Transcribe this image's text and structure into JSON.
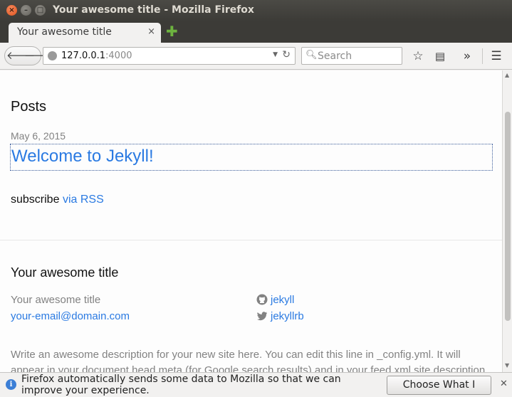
{
  "window": {
    "title": "Your awesome title - Mozilla Firefox"
  },
  "tabs": [
    {
      "label": "Your awesome title",
      "close": "×"
    }
  ],
  "navbar": {
    "url_host": "127.0.0.1",
    "url_port": ":4000",
    "search_placeholder": "Search"
  },
  "page": {
    "posts_heading": "Posts",
    "post": {
      "date": "May 6, 2015",
      "title": "Welcome to Jekyll!"
    },
    "subscribe_text": "subscribe",
    "subscribe_link": "via RSS",
    "footer": {
      "title": "Your awesome title",
      "name": "Your awesome title",
      "email": "your-email@domain.com",
      "github": "jekyll",
      "twitter": "jekyllrb",
      "description": "Write an awesome description for your new site here. You can edit this line in _config.yml. It will appear in your document head meta (for Google search results) and in your feed.xml site description."
    }
  },
  "notification": {
    "text": "Firefox automatically sends some data to Mozilla so that we can improve your experience.",
    "button": "Choose What I Share"
  }
}
